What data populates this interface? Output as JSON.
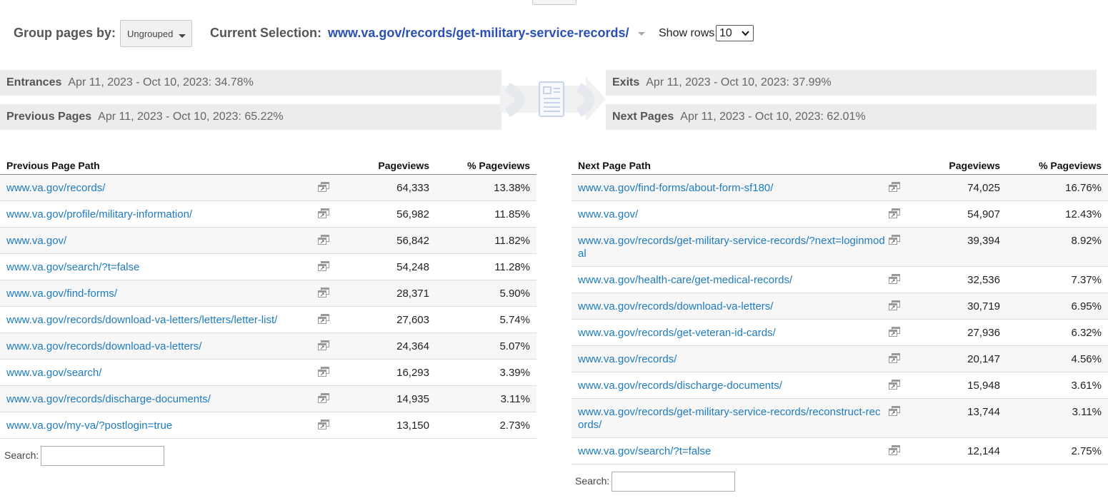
{
  "header": {
    "group_label": "Group pages by:",
    "group_value": "Ungrouped",
    "selection_label": "Current Selection:",
    "selection_url": "www.va.gov/records/get-military-service-records/",
    "show_rows_label": "Show rows:",
    "show_rows_value": "10"
  },
  "summary": {
    "entrances": {
      "label": "Entrances",
      "value": "Apr 11, 2023 - Oct 10, 2023: 34.78%"
    },
    "previous": {
      "label": "Previous Pages",
      "value": "Apr 11, 2023 - Oct 10, 2023: 65.22%"
    },
    "exits": {
      "label": "Exits",
      "value": "Apr 11, 2023 - Oct 10, 2023: 37.99%"
    },
    "next": {
      "label": "Next Pages",
      "value": "Apr 11, 2023 - Oct 10, 2023: 62.01%"
    }
  },
  "prev_table": {
    "headers": {
      "path": "Previous Page Path",
      "pageviews": "Pageviews",
      "pct": "% Pageviews"
    },
    "rows": [
      {
        "path": "www.va.gov/records/",
        "pageviews": "64,333",
        "pct": "13.38%"
      },
      {
        "path": "www.va.gov/profile/military-information/",
        "pageviews": "56,982",
        "pct": "11.85%"
      },
      {
        "path": "www.va.gov/",
        "pageviews": "56,842",
        "pct": "11.82%"
      },
      {
        "path": "www.va.gov/search/?t=false",
        "pageviews": "54,248",
        "pct": "11.28%"
      },
      {
        "path": "www.va.gov/find-forms/",
        "pageviews": "28,371",
        "pct": "5.90%"
      },
      {
        "path": "www.va.gov/records/download-va-letters/letters/letter-list/",
        "pageviews": "27,603",
        "pct": "5.74%"
      },
      {
        "path": "www.va.gov/records/download-va-letters/",
        "pageviews": "24,364",
        "pct": "5.07%"
      },
      {
        "path": "www.va.gov/search/",
        "pageviews": "16,293",
        "pct": "3.39%"
      },
      {
        "path": "www.va.gov/records/discharge-documents/",
        "pageviews": "14,935",
        "pct": "3.11%"
      },
      {
        "path": "www.va.gov/my-va/?postlogin=true",
        "pageviews": "13,150",
        "pct": "2.73%"
      }
    ],
    "search_label": "Search:"
  },
  "next_table": {
    "headers": {
      "path": "Next Page Path",
      "pageviews": "Pageviews",
      "pct": "% Pageviews"
    },
    "rows": [
      {
        "path": "www.va.gov/find-forms/about-form-sf180/",
        "pageviews": "74,025",
        "pct": "16.76%"
      },
      {
        "path": "www.va.gov/",
        "pageviews": "54,907",
        "pct": "12.43%"
      },
      {
        "path": "www.va.gov/records/get-military-service-records/?next=loginmodal",
        "pageviews": "39,394",
        "pct": "8.92%"
      },
      {
        "path": "www.va.gov/health-care/get-medical-records/",
        "pageviews": "32,536",
        "pct": "7.37%"
      },
      {
        "path": "www.va.gov/records/download-va-letters/",
        "pageviews": "30,719",
        "pct": "6.95%"
      },
      {
        "path": "www.va.gov/records/get-veteran-id-cards/",
        "pageviews": "27,936",
        "pct": "6.32%"
      },
      {
        "path": "www.va.gov/records/",
        "pageviews": "20,147",
        "pct": "4.56%"
      },
      {
        "path": "www.va.gov/records/discharge-documents/",
        "pageviews": "15,948",
        "pct": "3.61%"
      },
      {
        "path": "www.va.gov/records/get-military-service-records/reconstruct-records/",
        "pageviews": "13,744",
        "pct": "3.11%"
      },
      {
        "path": "www.va.gov/search/?t=false",
        "pageviews": "12,144",
        "pct": "2.75%"
      }
    ],
    "search_label": "Search:"
  },
  "icons": {
    "row_action": "open-in-new-window-icon",
    "flow": "page-flow-icon"
  },
  "colors": {
    "link": "#1e7bbf",
    "selection": "#2a4fb5",
    "bar_bg": "#ececec"
  }
}
